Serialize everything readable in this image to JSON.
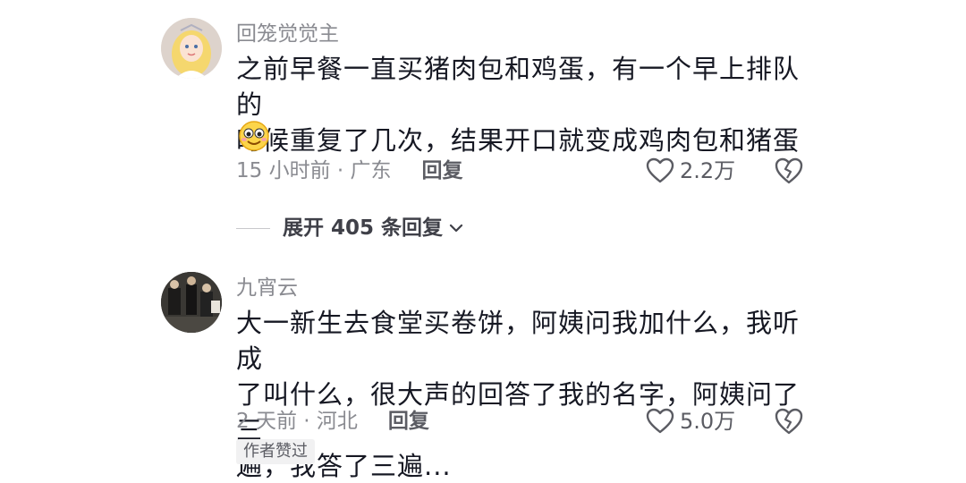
{
  "comments": [
    {
      "username": "回笼觉觉主",
      "text_line1": "之前早餐一直买猪肉包和鸡蛋，有一个早上排队的",
      "text_line2": "时候重复了几次，结果开口就变成鸡肉包和猪蛋",
      "emoji_icon": "smiling-face-emoji",
      "time_location": "15 小时前 · 广东",
      "reply_label": "回复",
      "like_count": "2.2万"
    },
    {
      "username": "九宵云",
      "text_line1": "大一新生去食堂买卷饼，阿姨问我加什么，我听成",
      "text_line2": "了叫什么，很大声的回答了我的名字，阿姨问了三",
      "text_line3": "遍，我答了三遍...",
      "time_location": "2 天前 · 河北",
      "reply_label": "回复",
      "like_count": "5.0万",
      "badge": "作者赞过"
    }
  ],
  "expand_replies": {
    "label": "展开 405 条回复"
  },
  "colors": {
    "primary_text": "#161823",
    "secondary_text": "#8a8b91",
    "badge_bg": "#f1f1f2"
  }
}
